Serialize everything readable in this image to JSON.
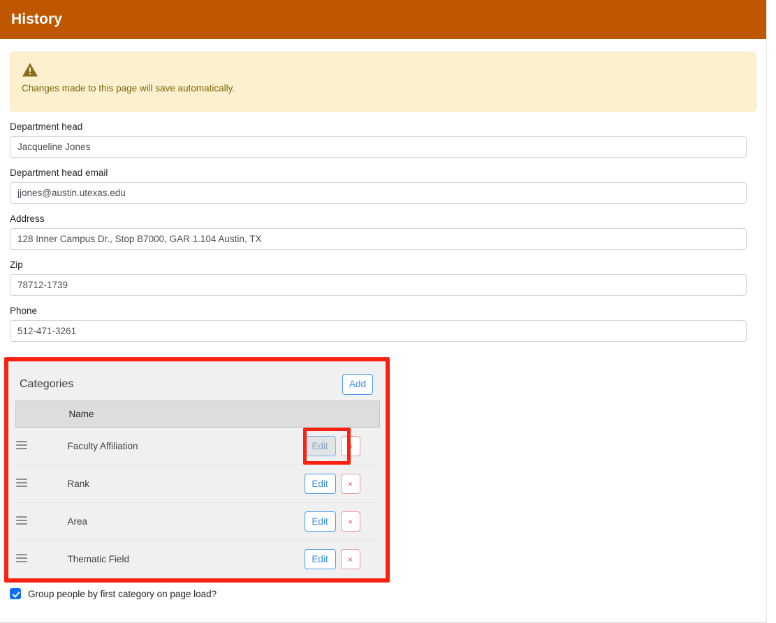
{
  "header": {
    "title": "History",
    "background_color": "#bf5700"
  },
  "alert": {
    "icon": "warning-triangle-icon",
    "message": "Changes made to this page will save automatically.",
    "background_color": "#fcf0cf",
    "text_color": "#7d6608"
  },
  "form": {
    "fields": [
      {
        "label": "Department head",
        "value": "Jacqueline Jones",
        "placeholder": "Department head",
        "name": "department-head"
      },
      {
        "label": "Department head email",
        "value": "jjones@austin.utexas.edu",
        "placeholder": "Department head email",
        "name": "department-head-email"
      },
      {
        "label": "Address",
        "value": "128 Inner Campus Dr., Stop B7000, GAR 1.104 Austin, TX",
        "placeholder": "Address",
        "name": "address"
      },
      {
        "label": "Zip",
        "value": "78712-1739",
        "placeholder": "Zip",
        "name": "zip"
      },
      {
        "label": "Phone",
        "value": "512-471-3261",
        "placeholder": "Phone",
        "name": "phone"
      }
    ]
  },
  "categories": {
    "title": "Categories",
    "add_label": "Add",
    "columns": [
      "",
      "Name",
      ""
    ],
    "name_column_header": "Name",
    "edit_label": "Edit",
    "delete_label": "×",
    "drag_handle_icon": "drag-handle-icon",
    "rows": [
      {
        "name": "Faculty Affiliation",
        "focused": true
      },
      {
        "name": "Rank",
        "focused": false
      },
      {
        "name": "Area",
        "focused": false
      },
      {
        "name": "Thematic Field",
        "focused": false
      }
    ],
    "accent_color": "#3a8ee6",
    "delete_color": "#e05260",
    "annotation_color": "#f92212"
  },
  "group_option": {
    "label": "Group people by first category on page load?",
    "checked": true,
    "checkbox_color": "#0d6efd"
  }
}
